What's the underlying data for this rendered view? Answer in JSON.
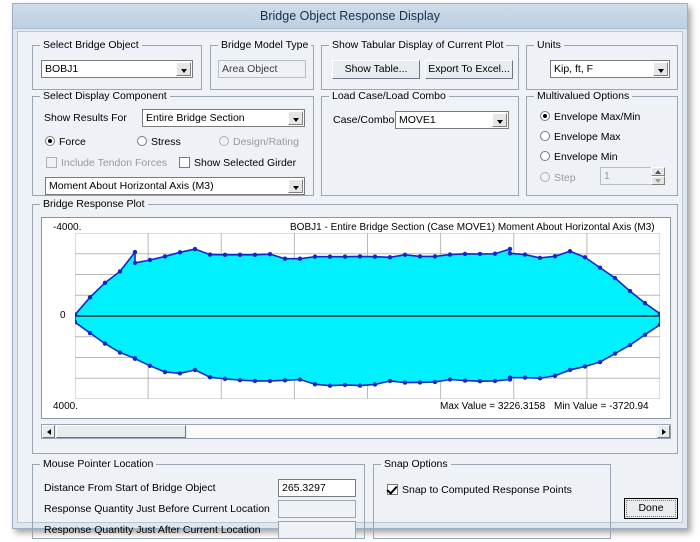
{
  "window": {
    "title": "Bridge Object Response Display"
  },
  "bridge_object": {
    "legend": "Select Bridge Object",
    "value": "BOBJ1"
  },
  "model_type": {
    "legend": "Bridge Model Type",
    "value": "Area Object"
  },
  "tabular": {
    "legend": "Show Tabular Display of Current Plot",
    "show_table_label": "Show Table...",
    "export_excel_label": "Export To Excel..."
  },
  "units": {
    "legend": "Units",
    "value": "Kip, ft, F"
  },
  "display_component": {
    "legend": "Select Display Component",
    "show_results_for_label": "Show Results For",
    "show_results_for_value": "Entire Bridge Section",
    "radio_force": "Force",
    "radio_stress": "Stress",
    "radio_design": "Design/Rating",
    "check_tendon": "Include Tendon Forces",
    "check_girder": "Show Selected Girder",
    "component_value": "Moment About Horizontal Axis  (M3)"
  },
  "load_case": {
    "legend": "Load Case/Load Combo",
    "case_label": "Case/Combo",
    "case_value": "MOVE1"
  },
  "multivalued": {
    "legend": "Multivalued Options",
    "opt_envelope_maxmin": "Envelope Max/Min",
    "opt_envelope_max": "Envelope Max",
    "opt_envelope_min": "Envelope Min",
    "opt_step": "Step",
    "step_value": "1"
  },
  "plot": {
    "legend": "Bridge Response Plot",
    "title": "BOBJ1 - Entire Bridge Section   (Case MOVE1)   Moment About Horizontal Axis  (M3)",
    "y_top_label": "-4000.",
    "y_zero_label": "0",
    "y_bottom_label": "4000.",
    "max_value_text": "Max Value = 3226.3158",
    "min_value_text": "Min Value = -3720.94",
    "fill_color": "#00f0ff",
    "line_color": "#1028c8",
    "point_color": "#1028c8",
    "zero_line_color": "#0d5d63",
    "grid_color": "#b9b9b9"
  },
  "chart_data": {
    "type": "area",
    "title": "BOBJ1 - Entire Bridge Section   (Case MOVE1)   Moment About Horizontal Axis  (M3)",
    "xlabel": "",
    "ylabel": "Moment About Horizontal Axis (M3)",
    "ylim": [
      -4000,
      4000
    ],
    "y_axis_inverted": true,
    "grid": true,
    "legend_position": "none",
    "annotations": [
      "Max Value = 3226.3158",
      "Min Value = -3720.94"
    ],
    "series": [
      {
        "name": "Envelope Max",
        "values": [
          -60,
          -900,
          -1600,
          -2150,
          -3080,
          -2560,
          -2700,
          -2870,
          -3070,
          -3226,
          -2960,
          -2950,
          -2950,
          -2950,
          -2980,
          -2760,
          -2760,
          -2860,
          -2860,
          -2860,
          -2870,
          -2860,
          -2830,
          -2950,
          -2870,
          -2870,
          -2960,
          -2990,
          -2990,
          -3000,
          -3230,
          -3020,
          -2960,
          -2800,
          -2880,
          -3120,
          -2830,
          -2330,
          -1830,
          -1200,
          -620,
          -110
        ]
      },
      {
        "name": "Envelope Min",
        "values": [
          300,
          820,
          1330,
          1760,
          2040,
          2060,
          2400,
          2700,
          2760,
          2600,
          2950,
          3030,
          3090,
          3130,
          3130,
          3100,
          3060,
          3290,
          3360,
          3320,
          3350,
          3300,
          3130,
          3210,
          3200,
          3180,
          3060,
          3110,
          3140,
          3130,
          3060,
          2970,
          2970,
          3000,
          2880,
          2600,
          2430,
          2220,
          1810,
          1400,
          900,
          420
        ]
      }
    ],
    "x": [
      0,
      14,
      28,
      42,
      56,
      56,
      70,
      84,
      98,
      112,
      126,
      140,
      154,
      168,
      182,
      196,
      210,
      224,
      238,
      252,
      266,
      280,
      294,
      308,
      322,
      336,
      350,
      364,
      378,
      392,
      406,
      406,
      420,
      434,
      448,
      462,
      476,
      490,
      504,
      518,
      532,
      546
    ]
  },
  "mouse_pointer": {
    "legend": "Mouse Pointer Location",
    "distance_label": "Distance From Start of Bridge Object",
    "distance_value": "265.3297",
    "before_label": "Response Quantity Just Before Current Location",
    "before_value": "",
    "after_label": "Response Quantity Just After Current Location",
    "after_value": ""
  },
  "snap": {
    "legend": "Snap Options",
    "check_label": "Snap to Computed Response Points"
  },
  "done_button": {
    "label": "Done"
  }
}
